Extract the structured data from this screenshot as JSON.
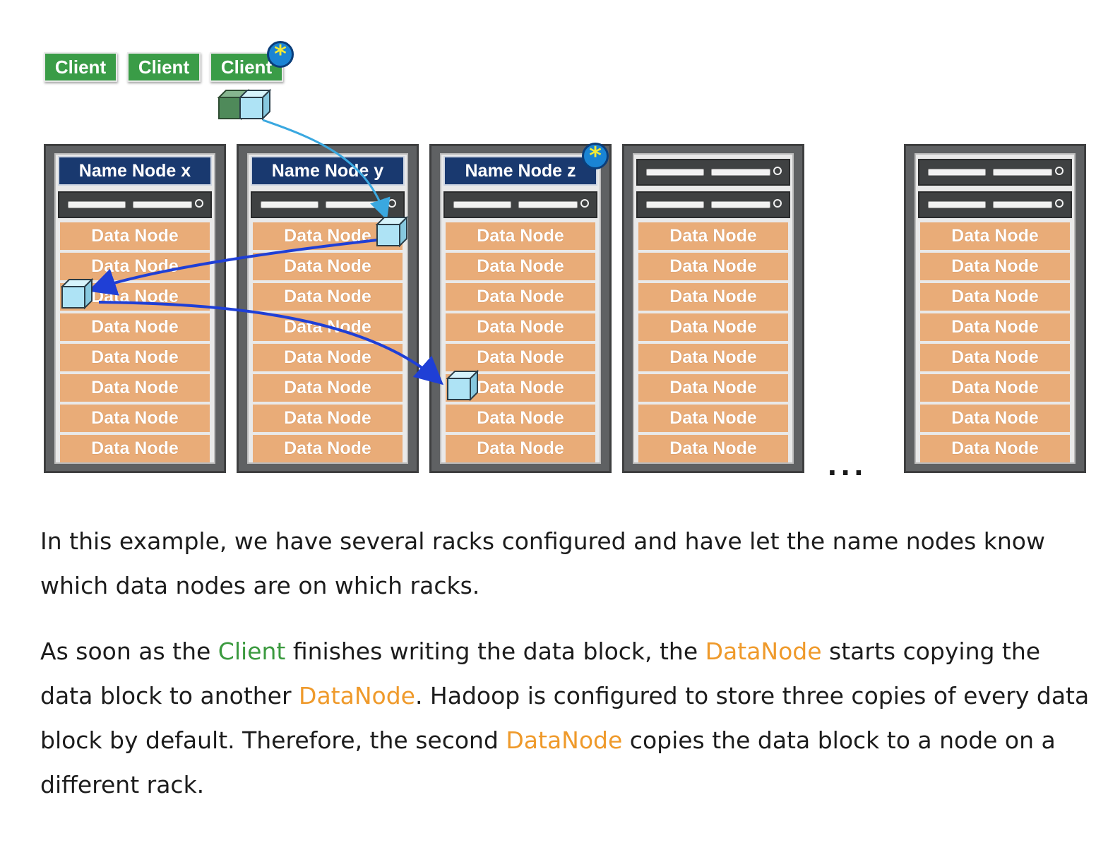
{
  "clients": [
    "Client",
    "Client",
    "Client"
  ],
  "racks": [
    {
      "header": "Name Node x",
      "data_nodes": [
        "Data Node",
        "Data Node",
        "Data Node",
        "Data Node",
        "Data Node",
        "Data Node",
        "Data Node",
        "Data Node"
      ]
    },
    {
      "header": "Name Node y",
      "data_nodes": [
        "Data Node",
        "Data Node",
        "Data Node",
        "Data Node",
        "Data Node",
        "Data Node",
        "Data Node",
        "Data Node"
      ]
    },
    {
      "header": "Name Node z",
      "data_nodes": [
        "Data Node",
        "Data Node",
        "Data Node",
        "Data Node",
        "Data Node",
        "Data Node",
        "Data Node",
        "Data Node"
      ]
    },
    {
      "header": "",
      "data_nodes": [
        "Data Node",
        "Data Node",
        "Data Node",
        "Data Node",
        "Data Node",
        "Data Node",
        "Data Node",
        "Data Node"
      ]
    },
    {
      "header": "",
      "data_nodes": [
        "Data Node",
        "Data Node",
        "Data Node",
        "Data Node",
        "Data Node",
        "Data Node",
        "Data Node",
        "Data Node"
      ]
    }
  ],
  "star_symbol": "*",
  "ellipsis": "...",
  "colors": {
    "client_green": "#3a9c47",
    "name_node_navy": "#19396f",
    "data_node_orange": "#e9ac78",
    "arrow_blue": "#1f3fd6",
    "arrow_light_blue": "#3aa8e0",
    "highlight_green": "#3b9a3f",
    "highlight_orange": "#ef9a2b"
  },
  "paragraph1": "In this example, we have several racks configured and have let the name nodes know which data nodes are on which racks.",
  "paragraph2": {
    "t1": "As soon as the ",
    "client": "Client",
    "t2": " finishes writing the data block, the ",
    "datanode1": "DataNode",
    "t3": " starts copying the data block to another ",
    "datanode2": "DataNode",
    "t4": ". Hadoop is configured to store three copies of every data block by default. Therefore, the second ",
    "datanode3": "DataNode",
    "t5": " copies the data block to a node on a different rack."
  }
}
